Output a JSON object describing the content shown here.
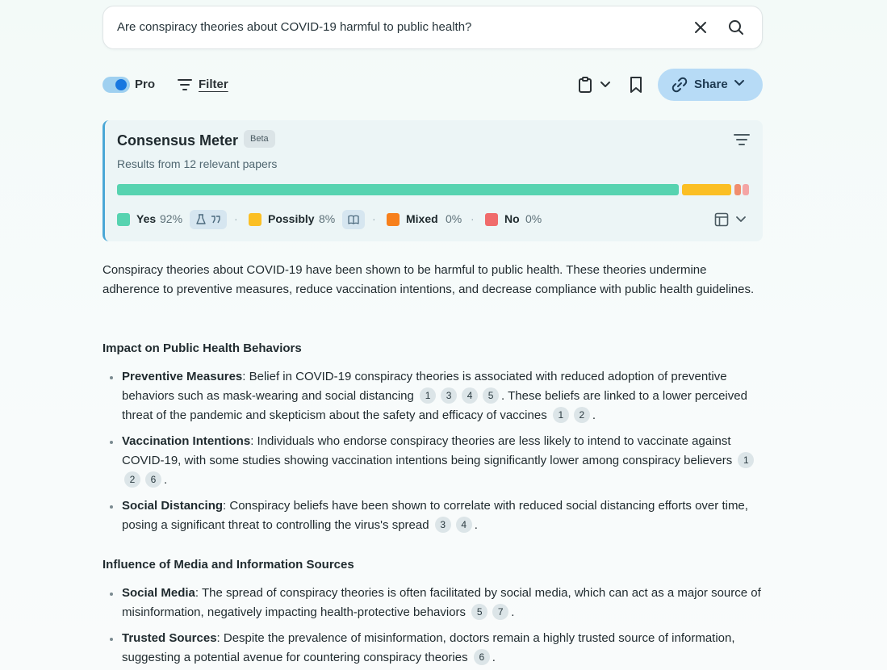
{
  "search": {
    "query": "Are conspiracy theories about COVID-19 harmful to public health?"
  },
  "toolbar": {
    "pro_label": "Pro",
    "pro_enabled": true,
    "filter_label": "Filter",
    "share_label": "Share"
  },
  "consensus": {
    "title": "Consensus Meter",
    "badge": "Beta",
    "subtitle": "Results from 12 relevant papers",
    "bar": [
      {
        "name": "Yes",
        "fraction": 0.92,
        "color": "#57d3b0"
      },
      {
        "name": "Possibly",
        "fraction": 0.08,
        "color": "#fbbf24"
      },
      {
        "name": "Mixed",
        "fraction": 0.0,
        "color": "#f08d6e"
      },
      {
        "name": "No",
        "fraction": 0.0,
        "color": "#f4a5a5"
      }
    ],
    "legend": [
      {
        "name": "Yes",
        "pct": "92%",
        "color": "#57d3b0"
      },
      {
        "name": "Possibly",
        "pct": "8%",
        "color": "#fbbf24"
      },
      {
        "name": "Mixed",
        "pct": "0%",
        "color": "#f7801c"
      },
      {
        "name": "No",
        "pct": "0%",
        "color": "#f06b6b"
      }
    ]
  },
  "summary": "Conspiracy theories about COVID-19 have been shown to be harmful to public health. These theories undermine adherence to preventive measures, reduce vaccination intentions, and decrease compliance with public health guidelines.",
  "sections": [
    {
      "heading": "Impact on Public Health Behaviors",
      "bullets": [
        {
          "term": "Preventive Measures",
          "text": ": Belief in COVID-19 conspiracy theories is associated with reduced adoption of preventive behaviors such as mask-wearing and social distancing",
          "cites1": [
            "1",
            "3",
            "4",
            "5"
          ],
          "text2": ". These beliefs are linked to a lower perceived threat of the pandemic and skepticism about the safety and efficacy of vaccines",
          "cites2": [
            "1",
            "2"
          ],
          "end": "."
        },
        {
          "term": "Vaccination Intentions",
          "text": ": Individuals who endorse conspiracy theories are less likely to intend to vaccinate against COVID-19, with some studies showing vaccination intentions being significantly lower among conspiracy believers",
          "cites1": [
            "1",
            "2",
            "6"
          ],
          "end": "."
        },
        {
          "term": "Social Distancing",
          "text": ": Conspiracy beliefs have been shown to correlate with reduced social distancing efforts over time, posing a significant threat to controlling the virus's spread",
          "cites1": [
            "3",
            "4"
          ],
          "end": "."
        }
      ]
    },
    {
      "heading": "Influence of Media and Information Sources",
      "bullets": [
        {
          "term": "Social Media",
          "text": ": The spread of conspiracy theories is often facilitated by social media, which can act as a major source of misinformation, negatively impacting health-protective behaviors",
          "cites1": [
            "5",
            "7"
          ],
          "end": "."
        },
        {
          "term": "Trusted Sources",
          "text": ": Despite the prevalence of misinformation, doctors remain a highly trusted source of information, suggesting a potential avenue for countering conspiracy theories",
          "cites1": [
            "6"
          ],
          "end": "."
        }
      ]
    }
  ]
}
